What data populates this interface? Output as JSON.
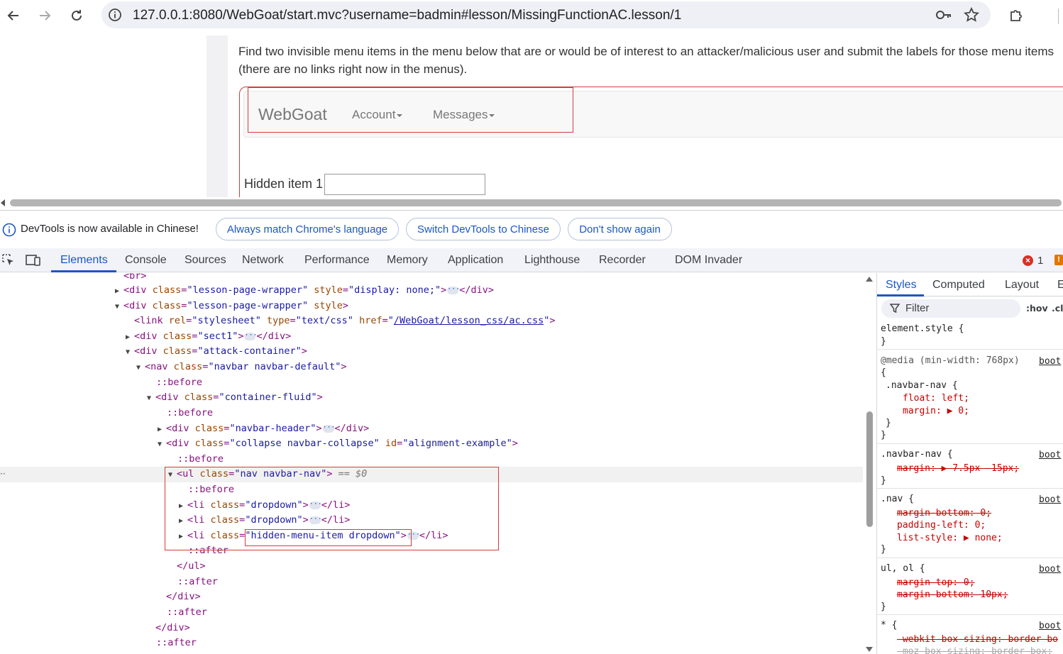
{
  "browser": {
    "url": "127.0.0.1:8080/WebGoat/start.mvc?username=badmin#lesson/MissingFunctionAC.lesson/1"
  },
  "page": {
    "instructions": "Find two invisible menu items in the menu below that are or would be of interest to an attacker/malicious user and submit the labels for those menu items (there are no links right now in the menus).",
    "navbar": {
      "brand": "WebGoat",
      "menus": [
        "Account",
        "Messages"
      ]
    },
    "hidden_item_label": "Hidden item 1",
    "hidden_item_value": ""
  },
  "devtools": {
    "infobar": {
      "message": "DevTools is now available in Chinese!",
      "buttons": [
        "Always match Chrome's language",
        "Switch DevTools to Chinese",
        "Don't show again"
      ]
    },
    "tabs": [
      "Elements",
      "Console",
      "Sources",
      "Network",
      "Performance",
      "Memory",
      "Application",
      "Lighthouse",
      "Recorder",
      "DOM Invader"
    ],
    "active_tab": "Elements",
    "error_count": "1",
    "dom_lines": [
      {
        "t": "<br>"
      },
      {
        "t": "<div class=\"lesson-page-wrapper\" style=\"display: none;\">…</div>"
      },
      {
        "t": "<div class=\"lesson-page-wrapper\" style>"
      },
      {
        "t": "<link rel=\"stylesheet\" type=\"text/css\" href=\"/WebGoat/lesson_css/ac.css\">"
      },
      {
        "t": "<div class=\"sect1\">…</div>"
      },
      {
        "t": "<div class=\"attack-container\">"
      },
      {
        "t": "<nav class=\"navbar navbar-default\">"
      },
      {
        "t": "::before"
      },
      {
        "t": "<div class=\"container-fluid\">"
      },
      {
        "t": "::before"
      },
      {
        "t": "<div class=\"navbar-header\">…</div>"
      },
      {
        "t": "<div class=\"collapse navbar-collapse\" id=\"alignment-example\">"
      },
      {
        "t": "::before"
      },
      {
        "t": "<ul class=\"nav navbar-nav\"> == $0"
      },
      {
        "t": "::before"
      },
      {
        "t": "<li class=\"dropdown\">…</li>"
      },
      {
        "t": "<li class=\"dropdown\">…</li>"
      },
      {
        "t": "<li class=\"hidden-menu-item dropdown\">…</li>"
      },
      {
        "t": "::after"
      },
      {
        "t": "</ul>"
      },
      {
        "t": "::after"
      },
      {
        "t": "</div>"
      },
      {
        "t": "::after"
      },
      {
        "t": "</div>"
      },
      {
        "t": "::after"
      }
    ],
    "styles_pane": {
      "tabs": [
        "Styles",
        "Computed",
        "Layout",
        "E"
      ],
      "active_tab": "Styles",
      "filter_placeholder": "Filter",
      "hov": ":hov",
      "cls": ".cl",
      "rules": [
        {
          "text": "element.style {"
        },
        {
          "text": "}"
        },
        {
          "text": "@media (min-width: 768px)",
          "source": "boot"
        },
        {
          "text": "{"
        },
        {
          "text": ".navbar-nav {"
        },
        {
          "text": "float: left;"
        },
        {
          "text": "margin: ▶ 0;"
        },
        {
          "text": "}"
        },
        {
          "text": "}"
        },
        {
          "text": ".navbar-nav {",
          "source": "boot"
        },
        {
          "text": "margin: ▶ 7.5px -15px;"
        },
        {
          "text": "}"
        },
        {
          "text": ".nav {",
          "source": "boot"
        },
        {
          "text": "margin-bottom: 0;"
        },
        {
          "text": "padding-left: 0;"
        },
        {
          "text": "list-style: ▶ none;"
        },
        {
          "text": "}"
        },
        {
          "text": "ul, ol {",
          "source": "boot"
        },
        {
          "text": "margin-top: 0;"
        },
        {
          "text": "margin-bottom: 10px;"
        },
        {
          "text": "}"
        },
        {
          "text": "* {",
          "source": "boot"
        },
        {
          "text": "-webkit-box-sizing: border-bo"
        },
        {
          "text": "-moz-box-sizing: border-box;"
        }
      ]
    }
  }
}
